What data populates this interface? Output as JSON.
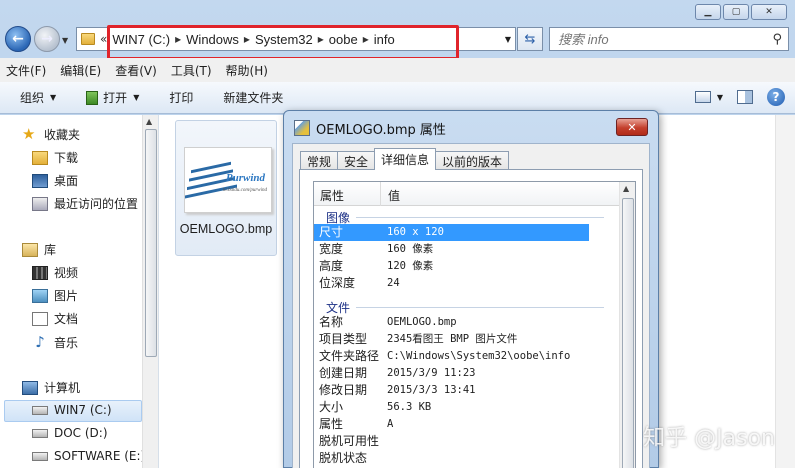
{
  "address": {
    "crumbs": [
      "WIN7 (C:)",
      "Windows",
      "System32",
      "oobe",
      "info"
    ],
    "overflow": "«"
  },
  "search": {
    "placeholder": "搜索 info"
  },
  "menu": [
    "文件(F)",
    "编辑(E)",
    "查看(V)",
    "工具(T)",
    "帮助(H)"
  ],
  "toolbar": {
    "organize": "组织",
    "open": "打开",
    "print": "打印",
    "new_folder": "新建文件夹"
  },
  "nav": {
    "favorites": "收藏夹",
    "downloads": "下载",
    "desktop": "桌面",
    "recent": "最近访问的位置",
    "libraries": "库",
    "videos": "视频",
    "pictures": "图片",
    "documents": "文档",
    "music": "音乐",
    "computer": "计算机",
    "drive_c": "WIN7 (C:)",
    "drive_d": "DOC (D:)",
    "drive_e": "SOFTWARE (E:)"
  },
  "file": {
    "name": "OEMLOGO.bmp",
    "thumb_logo": "Purwind",
    "thumb_url": "hi.baidu.com/purwind"
  },
  "dialog": {
    "title": "OEMLOGO.bmp 属性",
    "tabs": [
      "常规",
      "安全",
      "详细信息",
      "以前的版本"
    ],
    "active_tab": "详细信息",
    "header_property": "属性",
    "header_value": "值",
    "groups": {
      "image": "图像",
      "file": "文件"
    },
    "image_rows": [
      {
        "name": "尺寸",
        "value": "160 x 120"
      },
      {
        "name": "宽度",
        "value": "160 像素"
      },
      {
        "name": "高度",
        "value": "120 像素"
      },
      {
        "name": "位深度",
        "value": "24"
      }
    ],
    "file_rows": [
      {
        "name": "名称",
        "value": "OEMLOGO.bmp"
      },
      {
        "name": "项目类型",
        "value": "2345看图王 BMP 图片文件"
      },
      {
        "name": "文件夹路径",
        "value": "C:\\Windows\\System32\\oobe\\info"
      },
      {
        "name": "创建日期",
        "value": "2015/3/9 11:23"
      },
      {
        "name": "修改日期",
        "value": "2015/3/3 13:41"
      },
      {
        "name": "大小",
        "value": "56.3 KB"
      },
      {
        "name": "属性",
        "value": "A"
      },
      {
        "name": "脱机可用性",
        "value": ""
      },
      {
        "name": "脱机状态",
        "value": ""
      }
    ]
  },
  "watermark": "知乎 @Jason",
  "colors": {
    "selection": "#3399ff",
    "highlight_box": "#e0242b",
    "group_header": "#1e3287"
  }
}
